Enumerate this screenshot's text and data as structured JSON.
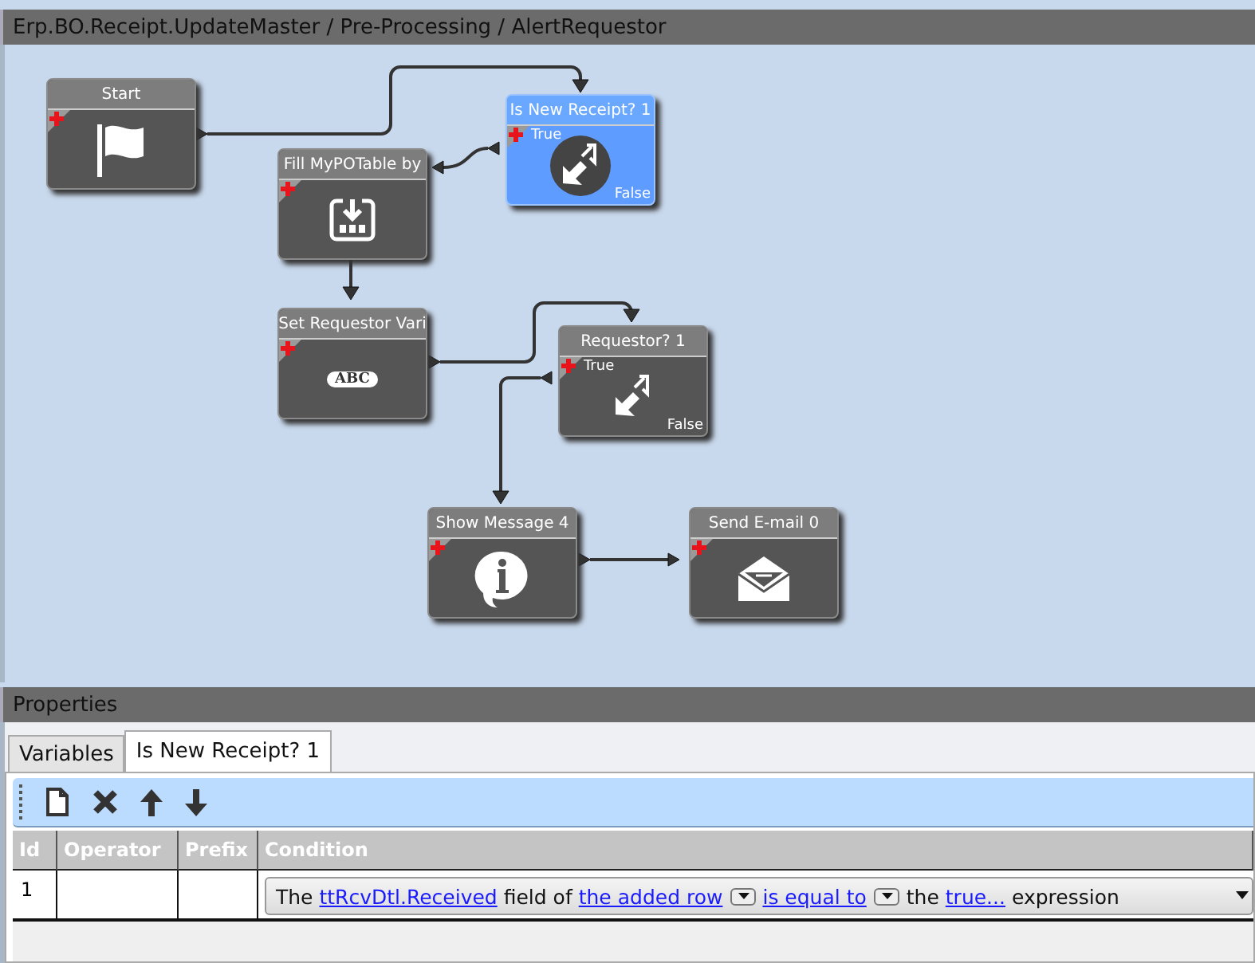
{
  "window": {
    "title": "Erp.BO.Receipt.UpdateMaster / Pre-Processing / AlertRequestor"
  },
  "canvas": {
    "nodes": [
      {
        "kind": "start",
        "title": "Start",
        "selected": false
      },
      {
        "kind": "decision",
        "title": "Is New Receipt? 1",
        "selected": true,
        "true_label": "True",
        "false_label": "False"
      },
      {
        "kind": "fill",
        "title": "Fill MyPOTable by",
        "selected": false
      },
      {
        "kind": "set",
        "title": "Set Requestor Vari",
        "selected": false,
        "icon_text": "ABC"
      },
      {
        "kind": "decision",
        "title": "Requestor? 1",
        "selected": false,
        "true_label": "True",
        "false_label": "False"
      },
      {
        "kind": "message",
        "title": "Show Message 4",
        "selected": false
      },
      {
        "kind": "email",
        "title": "Send E-mail 0",
        "selected": false
      }
    ]
  },
  "properties": {
    "title": "Properties",
    "tabs": [
      {
        "label": "Variables",
        "selected": false
      },
      {
        "label": "Is New Receipt? 1",
        "selected": true
      }
    ],
    "table": {
      "columns": [
        "Id",
        "Operator",
        "Prefix",
        "Condition"
      ],
      "rows": [
        {
          "id": "1",
          "operator": "",
          "prefix": "",
          "condition": [
            {
              "kind": "text",
              "text": "The"
            },
            {
              "kind": "link",
              "text": "ttRcvDtl.Received"
            },
            {
              "kind": "text",
              "text": "field of"
            },
            {
              "kind": "link_dropdown",
              "text": "the added row"
            },
            {
              "kind": "link_dropdown",
              "text": "is equal to"
            },
            {
              "kind": "text",
              "text": "the"
            },
            {
              "kind": "link",
              "text": "true..."
            },
            {
              "kind": "text",
              "text": "expression"
            }
          ]
        }
      ]
    }
  }
}
